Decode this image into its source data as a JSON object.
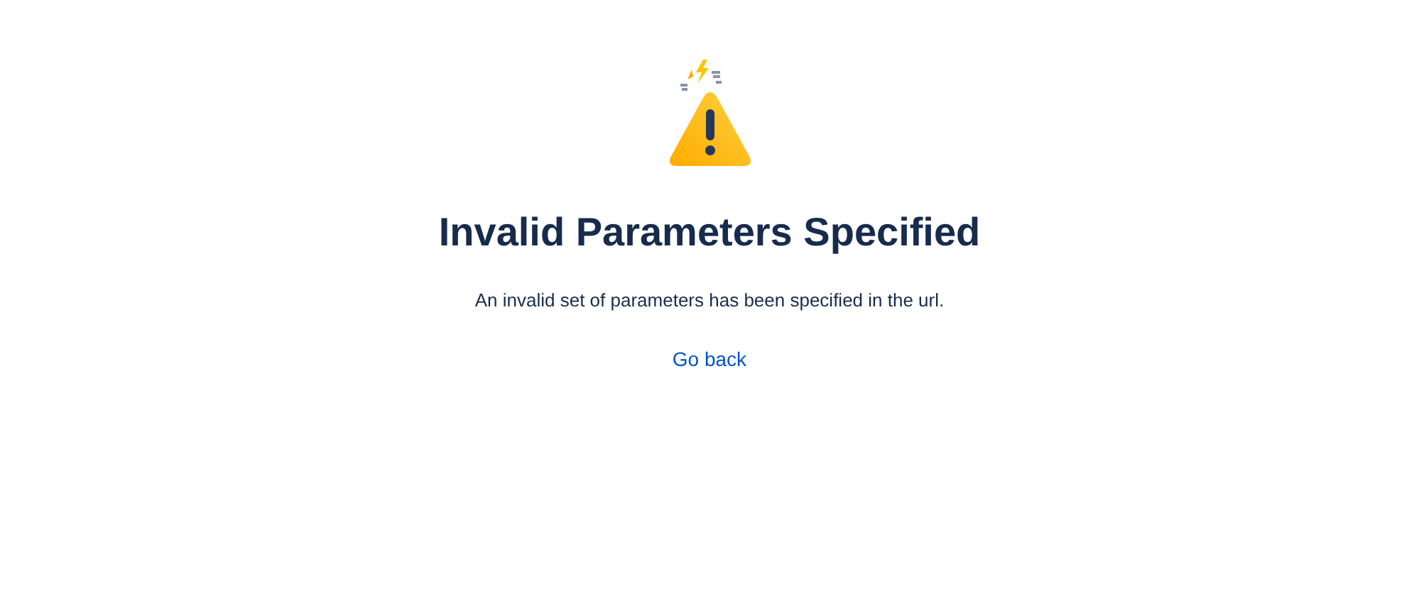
{
  "heading": "Invalid Parameters Specified",
  "message": "An invalid set of parameters has been specified in the url.",
  "link": "Go back"
}
